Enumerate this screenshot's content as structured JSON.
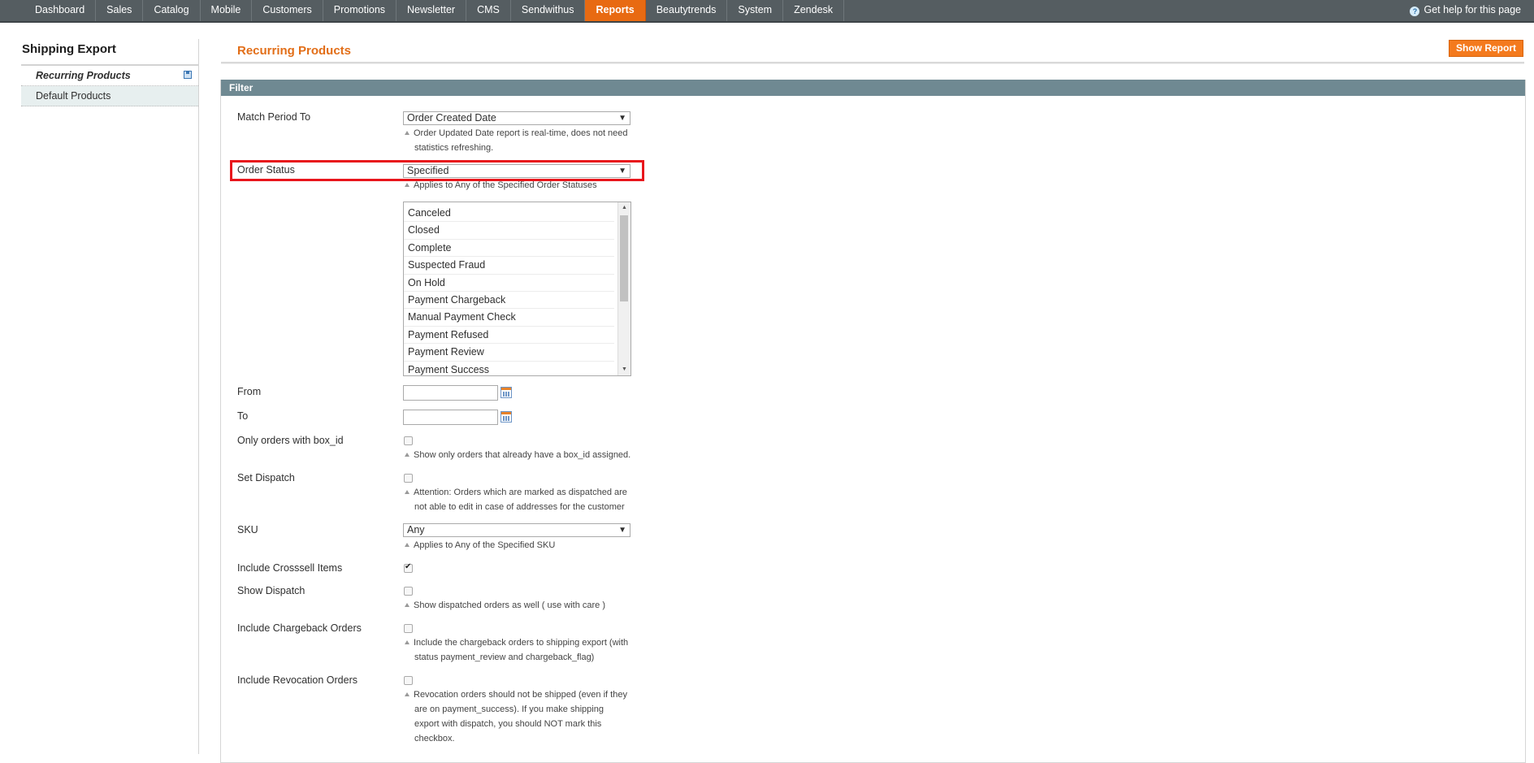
{
  "nav": {
    "items": [
      "Dashboard",
      "Sales",
      "Catalog",
      "Mobile",
      "Customers",
      "Promotions",
      "Newsletter",
      "CMS",
      "Sendwithus",
      "Reports",
      "Beautytrends",
      "System",
      "Zendesk"
    ],
    "active": "Reports",
    "help": "Get help for this page"
  },
  "sidebar": {
    "title": "Shipping Export",
    "items": [
      {
        "label": "Recurring Products",
        "active": true
      },
      {
        "label": "Default Products",
        "active": false
      }
    ]
  },
  "page": {
    "title": "Recurring Products",
    "show_report": "Show Report"
  },
  "filter": {
    "heading": "Filter",
    "match_period": {
      "label": "Match Period To",
      "value": "Order Created Date",
      "note1": "Order Updated Date report is real-time, does not need",
      "note2": "statistics refreshing."
    },
    "order_status": {
      "label": "Order Status",
      "value": "Specified",
      "note": "Applies to Any of the Specified Order Statuses"
    },
    "statuses": [
      "Canceled",
      "Closed",
      "Complete",
      "Suspected Fraud",
      "On Hold",
      "Payment Chargeback",
      "Manual Payment Check",
      "Payment Refused",
      "Payment Review",
      "Payment Success"
    ],
    "from": {
      "label": "From",
      "value": ""
    },
    "to": {
      "label": "To",
      "value": ""
    },
    "box_id": {
      "label": "Only orders with box_id",
      "checked": false,
      "note": "Show only orders that already have a box_id assigned."
    },
    "set_dispatch": {
      "label": "Set Dispatch",
      "checked": false,
      "note1": "Attention: Orders which are marked as dispatched are",
      "note2": "not able to edit in case of addresses for the customer"
    },
    "sku": {
      "label": "SKU",
      "value": "Any",
      "note": "Applies to Any of the Specified SKU"
    },
    "crosssell": {
      "label": "Include Crosssell Items",
      "checked": true
    },
    "show_dispatch": {
      "label": "Show Dispatch",
      "checked": false,
      "note": "Show dispatched orders as well ( use with care )"
    },
    "chargeback": {
      "label": "Include Chargeback Orders",
      "checked": false,
      "note1": "Include the chargeback orders to shipping export (with",
      "note2": "status payment_review and chargeback_flag)"
    },
    "revocation": {
      "label": "Include Revocation Orders",
      "checked": false,
      "note1": "Revocation orders should not be shipped (even if they",
      "note2": "are on payment_success). If you make shipping",
      "note3": "export with dispatch, you should NOT mark this",
      "note4": "checkbox."
    }
  },
  "colors": {
    "accent": "#e86a12",
    "nav_bg": "#555d61",
    "filter_head": "#6f8992",
    "highlight": "#e8161c"
  }
}
